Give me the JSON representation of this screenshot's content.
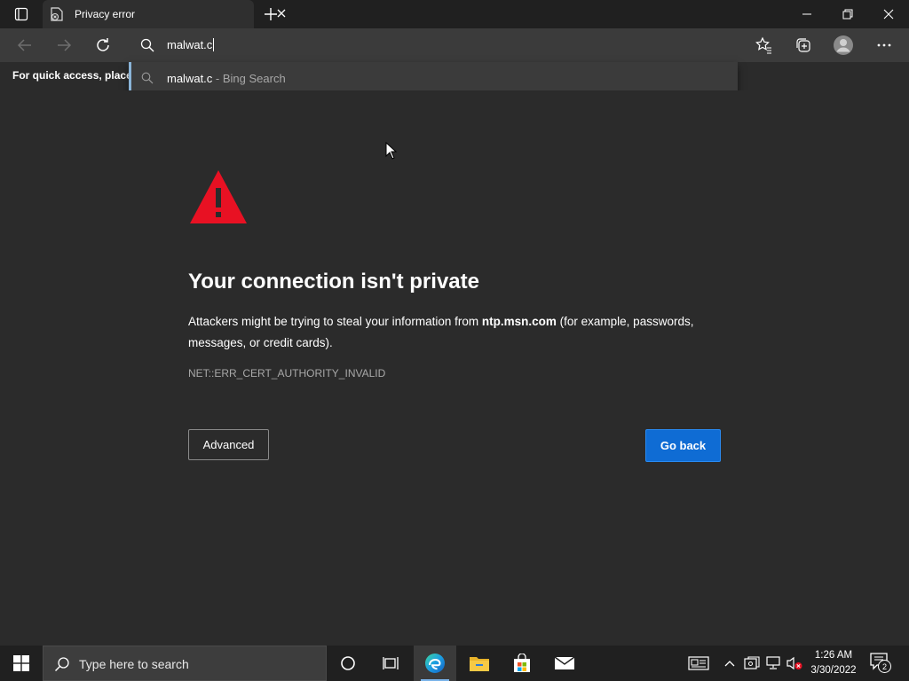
{
  "tab": {
    "title": "Privacy error"
  },
  "address_bar": {
    "value": "malwat.c"
  },
  "suggestion": {
    "query": "malwat.c",
    "source": " - Bing Search"
  },
  "favorites_bar": {
    "hint": "For quick access, place y"
  },
  "error_page": {
    "heading": "Your connection isn't private",
    "desc_before": "Attackers might be trying to steal your information from ",
    "domain": "ntp.msn.com",
    "desc_after": " (for example, passwords, messages, or credit cards).",
    "error_code": "NET::ERR_CERT_AUTHORITY_INVALID",
    "advanced_label": "Advanced",
    "go_back_label": "Go back"
  },
  "taskbar": {
    "search_placeholder": "Type here to search",
    "time": "1:26 AM",
    "date": "3/30/2022",
    "notification_count": "2"
  },
  "colors": {
    "warning_red": "#e81123",
    "primary_button": "#0f6cd4",
    "suggestion_accent": "#8ab4d8"
  }
}
